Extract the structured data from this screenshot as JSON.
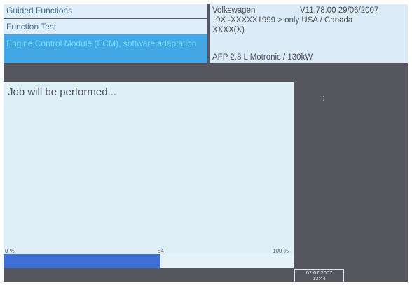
{
  "header": {
    "nav": [
      "Guided Functions",
      "Function Test",
      "Engine Control Module (ECM), software adaptation"
    ],
    "vehicle": {
      "make": "Volkswagen",
      "version": "V11.78.00 29/06/2007",
      "vin_line": "9X -XXXXX1999 > only USA / Canada",
      "model_code": "XXXX(X)",
      "engine": "AFP 2.8 L Motronic / 130kW"
    }
  },
  "main": {
    "message": "Job will be performed...",
    "progress": {
      "min_label": "0 %",
      "mid_label": "54",
      "max_label": "100 %",
      "value": 0.54
    }
  },
  "status": {
    "date": "02.07.2007",
    "time": "13:44"
  },
  "colors": {
    "background": "#56565e",
    "selected_row": "#43a7e6",
    "progress_fill": "#3d6fd6"
  }
}
